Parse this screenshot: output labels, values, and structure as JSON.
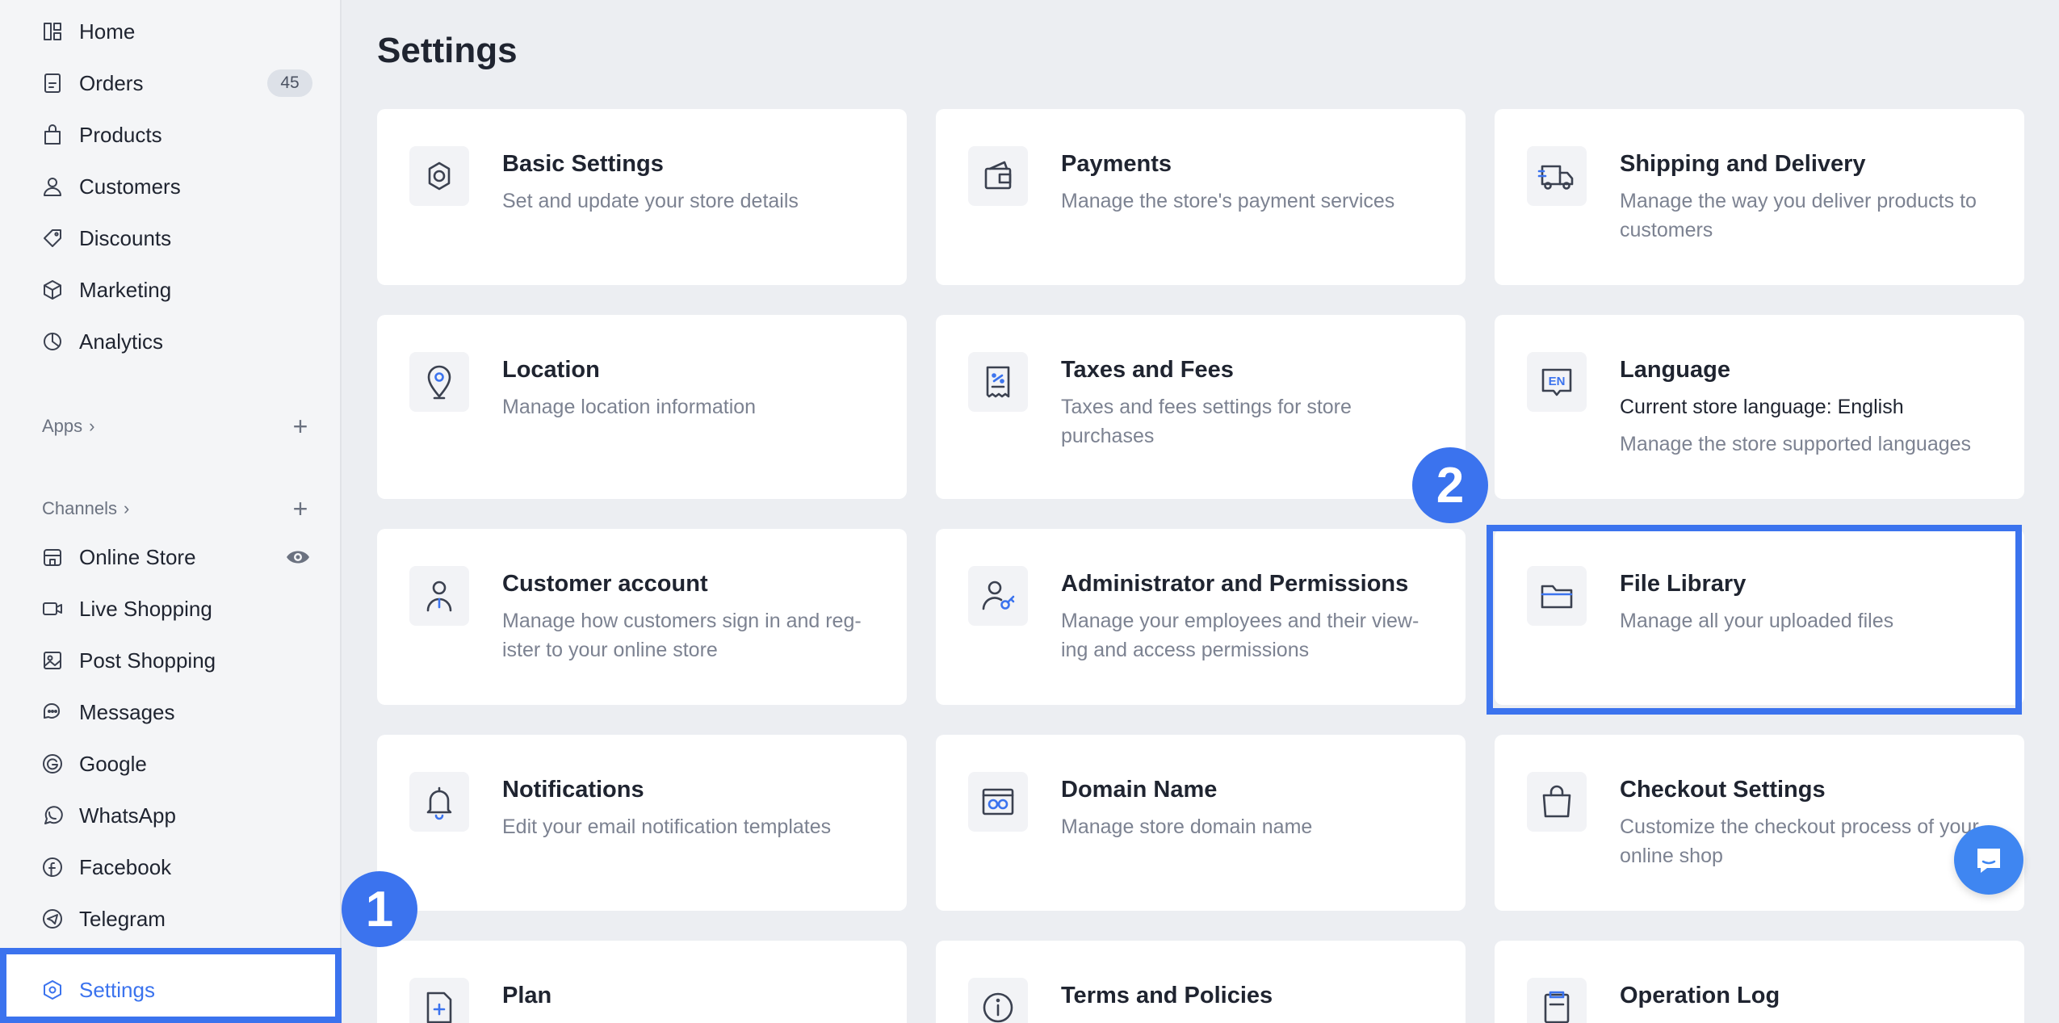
{
  "sidebar": {
    "items": [
      {
        "label": "Home",
        "icon": "home-icon"
      },
      {
        "label": "Orders",
        "icon": "orders-icon",
        "badge": "45"
      },
      {
        "label": "Products",
        "icon": "products-bag-icon"
      },
      {
        "label": "Customers",
        "icon": "customers-person-icon"
      },
      {
        "label": "Discounts",
        "icon": "discount-tag-icon"
      },
      {
        "label": "Marketing",
        "icon": "marketing-cube-icon"
      },
      {
        "label": "Analytics",
        "icon": "analytics-pie-icon"
      }
    ],
    "apps": {
      "label": "Apps",
      "chevron": "›",
      "add": "+"
    },
    "channels": {
      "label": "Channels",
      "chevron": "›",
      "add": "+"
    },
    "channel_items": [
      {
        "label": "Online Store",
        "icon": "store-icon"
      },
      {
        "label": "Live Shopping",
        "icon": "video-icon"
      },
      {
        "label": "Post Shopping",
        "icon": "image-post-icon"
      },
      {
        "label": "Messages",
        "icon": "messages-icon"
      },
      {
        "label": "Google",
        "icon": "google-icon"
      },
      {
        "label": "WhatsApp",
        "icon": "whatsapp-icon"
      },
      {
        "label": "Facebook",
        "icon": "facebook-icon"
      },
      {
        "label": "Telegram",
        "icon": "telegram-icon"
      }
    ],
    "settings": {
      "label": "Settings",
      "icon": "settings-hex-icon"
    }
  },
  "main": {
    "title": "Settings",
    "cards": [
      {
        "title": "Basic Settings",
        "desc": "Set and update your store details",
        "icon": "gear-icon"
      },
      {
        "title": "Payments",
        "desc": "Manage the store's payment services",
        "icon": "wallet-icon"
      },
      {
        "title": "Shipping and Delivery",
        "desc": "Manage the way you deliver products to customers",
        "icon": "truck-icon"
      },
      {
        "title": "Location",
        "desc": "Manage location information",
        "icon": "location-pin-icon"
      },
      {
        "title": "Taxes and Fees",
        "desc": "Taxes and fees settings for store purchases",
        "icon": "receipt-icon"
      },
      {
        "title": "Language",
        "sub": "Current store language: English",
        "desc": "Manage the store supported languages",
        "icon": "language-en-icon",
        "icon_text": "EN"
      },
      {
        "title": "Customer account",
        "desc": "Manage how customers sign in and reg-ister to your online store",
        "icon": "customer-account-icon"
      },
      {
        "title": "Administrator and Permissions",
        "desc": "Manage your employees and their view-ing and access permissions",
        "icon": "admin-key-icon"
      },
      {
        "title": "File Library",
        "desc": "Manage all your uploaded files",
        "icon": "folder-icon"
      },
      {
        "title": "Notifications",
        "desc": "Edit your email notification templates",
        "icon": "bell-icon"
      },
      {
        "title": "Domain Name",
        "desc": "Manage store domain name",
        "icon": "domain-link-icon"
      },
      {
        "title": "Checkout Settings",
        "desc": "Customize the checkout process of your online shop",
        "icon": "shopping-bag-icon"
      },
      {
        "title": "Plan",
        "desc": "",
        "icon": "plan-doc-icon"
      },
      {
        "title": "Terms and Policies",
        "desc": "",
        "icon": "info-icon"
      },
      {
        "title": "Operation Log",
        "desc": "",
        "icon": "log-clipboard-icon"
      }
    ]
  },
  "markers": {
    "first": "1",
    "second": "2"
  },
  "colors": {
    "accent": "#3b73ee",
    "background": "#eceef2",
    "card": "#ffffff",
    "muted_text": "#7c8291"
  }
}
